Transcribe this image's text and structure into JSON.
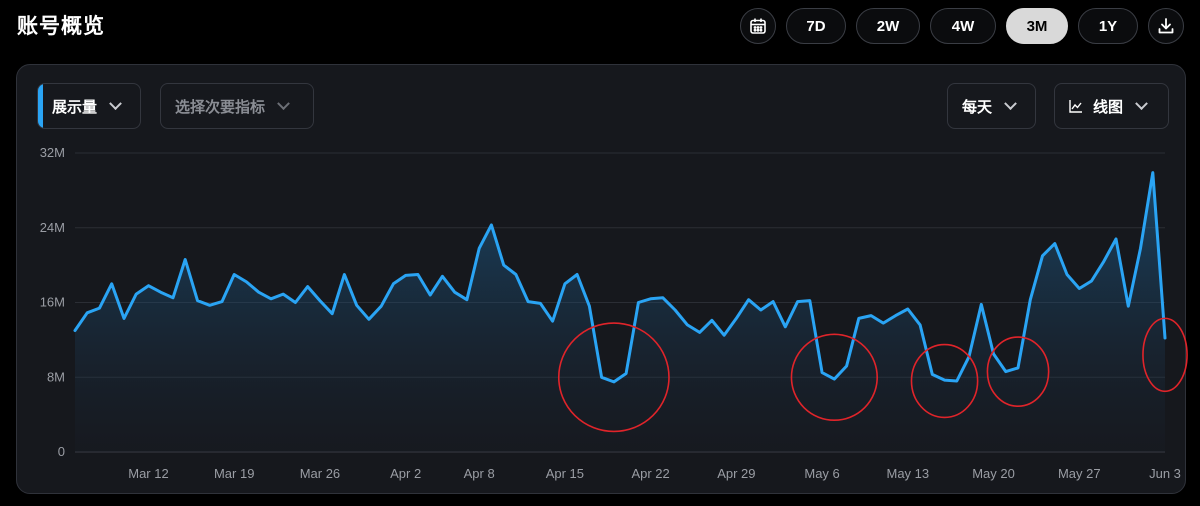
{
  "header": {
    "title": "账号概览"
  },
  "range_buttons": [
    {
      "label": "7D",
      "active": false
    },
    {
      "label": "2W",
      "active": false
    },
    {
      "label": "4W",
      "active": false
    },
    {
      "label": "3M",
      "active": true
    },
    {
      "label": "1Y",
      "active": false
    }
  ],
  "icons": {
    "calendar": "calendar-icon",
    "download": "download-icon",
    "chart_type": "line-chart-icon",
    "chevron": "chevron-down-icon"
  },
  "controls": {
    "primary_metric": "展示量",
    "secondary_metric_placeholder": "选择次要指标",
    "granularity": "每天",
    "chart_type": "线图"
  },
  "colors": {
    "accent": "#2aa4f4",
    "annotation": "#e0242a",
    "active_button": "#d9d9d9"
  },
  "chart_data": {
    "type": "area",
    "x": [
      "Mar 6",
      "Mar 7",
      "Mar 8",
      "Mar 9",
      "Mar 10",
      "Mar 11",
      "Mar 12",
      "Mar 13",
      "Mar 14",
      "Mar 15",
      "Mar 16",
      "Mar 17",
      "Mar 18",
      "Mar 19",
      "Mar 20",
      "Mar 21",
      "Mar 22",
      "Mar 23",
      "Mar 24",
      "Mar 25",
      "Mar 26",
      "Mar 27",
      "Mar 28",
      "Mar 29",
      "Mar 30",
      "Mar 31",
      "Apr 1",
      "Apr 2",
      "Apr 3",
      "Apr 4",
      "Apr 5",
      "Apr 6",
      "Apr 7",
      "Apr 8",
      "Apr 9",
      "Apr 10",
      "Apr 11",
      "Apr 12",
      "Apr 13",
      "Apr 14",
      "Apr 15",
      "Apr 16",
      "Apr 17",
      "Apr 18",
      "Apr 19",
      "Apr 20",
      "Apr 21",
      "Apr 22",
      "Apr 23",
      "Apr 24",
      "Apr 25",
      "Apr 26",
      "Apr 27",
      "Apr 28",
      "Apr 29",
      "Apr 30",
      "May 1",
      "May 2",
      "May 3",
      "May 4",
      "May 5",
      "May 6",
      "May 7",
      "May 8",
      "May 9",
      "May 10",
      "May 11",
      "May 12",
      "May 13",
      "May 14",
      "May 15",
      "May 16",
      "May 17",
      "May 18",
      "May 19",
      "May 20",
      "May 21",
      "May 22",
      "May 23",
      "May 24",
      "May 25",
      "May 26",
      "May 27",
      "May 28",
      "May 29",
      "May 30",
      "May 31",
      "Jun 1",
      "Jun 2",
      "Jun 3"
    ],
    "values": [
      13.0,
      14.9,
      15.4,
      18.0,
      14.3,
      16.9,
      17.8,
      17.1,
      16.5,
      20.6,
      16.2,
      15.7,
      16.1,
      19.0,
      18.2,
      17.1,
      16.4,
      16.9,
      16.0,
      17.7,
      16.2,
      14.8,
      19.0,
      15.7,
      14.2,
      15.6,
      18.0,
      18.9,
      19.0,
      16.8,
      18.8,
      17.1,
      16.3,
      21.8,
      24.3,
      20.0,
      19.0,
      16.1,
      15.9,
      14.0,
      18.0,
      19.0,
      15.6,
      8.0,
      7.5,
      8.4,
      16.0,
      16.4,
      16.5,
      15.2,
      13.6,
      12.8,
      14.1,
      12.5,
      14.3,
      16.3,
      15.2,
      16.1,
      13.4,
      16.1,
      16.2,
      8.5,
      7.8,
      9.2,
      14.3,
      14.6,
      13.8,
      14.6,
      15.3,
      13.6,
      8.3,
      7.7,
      7.6,
      10.2,
      15.8,
      10.5,
      8.6,
      9.0,
      16.3,
      21.0,
      22.3,
      19.0,
      17.5,
      18.3,
      20.4,
      22.8,
      15.6,
      21.8,
      29.9,
      12.2
    ],
    "xticks": [
      "Mar 12",
      "Mar 19",
      "Mar 26",
      "Apr 2",
      "Apr 8",
      "Apr 15",
      "Apr 22",
      "Apr 29",
      "May 6",
      "May 13",
      "May 20",
      "May 27",
      "Jun 3"
    ],
    "ytick_labels": [
      "0",
      "8M",
      "16M",
      "24M",
      "32M"
    ],
    "yticks": [
      0,
      8,
      16,
      24,
      32
    ],
    "ylim": [
      0,
      32
    ],
    "grid": true,
    "annotations": [
      {
        "shape": "ellipse",
        "x_center": "Apr 19",
        "y_center": 8.0,
        "x_halfwidth_days": 4.5,
        "y_halfheight": 5.8
      },
      {
        "shape": "ellipse",
        "x_center": "May 7",
        "y_center": 8.0,
        "x_halfwidth_days": 3.5,
        "y_halfheight": 4.6
      },
      {
        "shape": "ellipse",
        "x_center": "May 16",
        "y_center": 7.6,
        "x_halfwidth_days": 2.7,
        "y_halfheight": 3.9
      },
      {
        "shape": "ellipse",
        "x_center": "May 22",
        "y_center": 8.6,
        "x_halfwidth_days": 2.5,
        "y_halfheight": 3.7
      },
      {
        "shape": "ellipse",
        "x_center": "Jun 3",
        "y_center": 10.4,
        "x_halfwidth_days": 1.8,
        "y_halfheight": 3.9
      }
    ]
  }
}
